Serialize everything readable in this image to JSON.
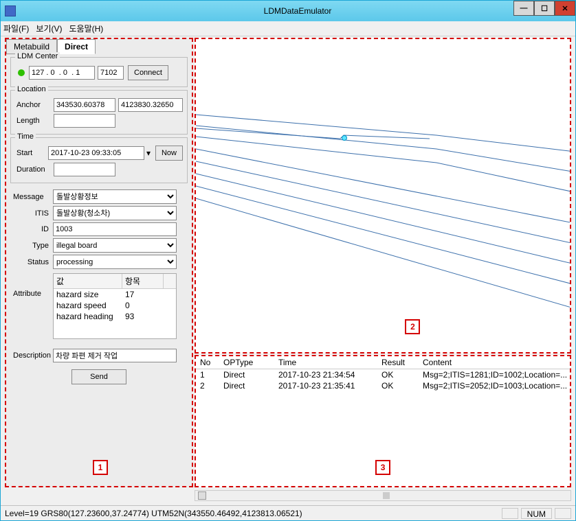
{
  "window": {
    "title": "LDMDataEmulator"
  },
  "menu": {
    "file": "파일(F)",
    "view": "보기(V)",
    "help": "도움말(H)"
  },
  "tabs": {
    "metabuild": "Metabuild",
    "direct": "Direct"
  },
  "ldm": {
    "legend": "LDM Center",
    "ip": "127 . 0  . 0  . 1",
    "port": "7102",
    "connect": "Connect"
  },
  "location": {
    "legend": "Location",
    "anchor_label": "Anchor",
    "anchor_x": "343530.60378",
    "anchor_y": "4123830.32650",
    "length_label": "Length",
    "length": ""
  },
  "time": {
    "legend": "Time",
    "start_label": "Start",
    "start": "2017-10-23 09:33:05",
    "now": "Now",
    "duration_label": "Duration",
    "duration": ""
  },
  "form": {
    "message_label": "Message",
    "message": "돌발상황정보",
    "itis_label": "ITIS",
    "itis": "돌발상황(청소차)",
    "id_label": "ID",
    "id": "1003",
    "type_label": "Type",
    "type": "illegal board",
    "status_label": "Status",
    "status": "processing",
    "attr_label": "Attribute",
    "attr_hdr1": "값",
    "attr_hdr2": "항목",
    "attrs": [
      {
        "k": "hazard size",
        "v": "17"
      },
      {
        "k": "hazard speed",
        "v": "0"
      },
      {
        "k": "hazard heading",
        "v": "93"
      }
    ],
    "desc_label": "Description",
    "desc": "차량 파편 제거 작업",
    "send": "Send"
  },
  "log": {
    "hdr": {
      "no": "No",
      "type": "OPType",
      "time": "Time",
      "result": "Result",
      "content": "Content"
    },
    "rows": [
      {
        "no": "1",
        "type": "Direct",
        "time": "2017-10-23 21:34:54",
        "result": "OK",
        "content": "Msg=2;ITIS=1281;ID=1002;Location=..."
      },
      {
        "no": "2",
        "type": "Direct",
        "time": "2017-10-23 21:35:41",
        "result": "OK",
        "content": "Msg=2;ITIS=2052;ID=1003;Location=..."
      }
    ]
  },
  "status": {
    "text": "Level=19 GRS80(127.23600,37.24774) UTM52N(343550.46492,4123813.06521)",
    "num": "NUM"
  },
  "annot": {
    "p1": "1",
    "p2": "2",
    "p3": "3"
  }
}
